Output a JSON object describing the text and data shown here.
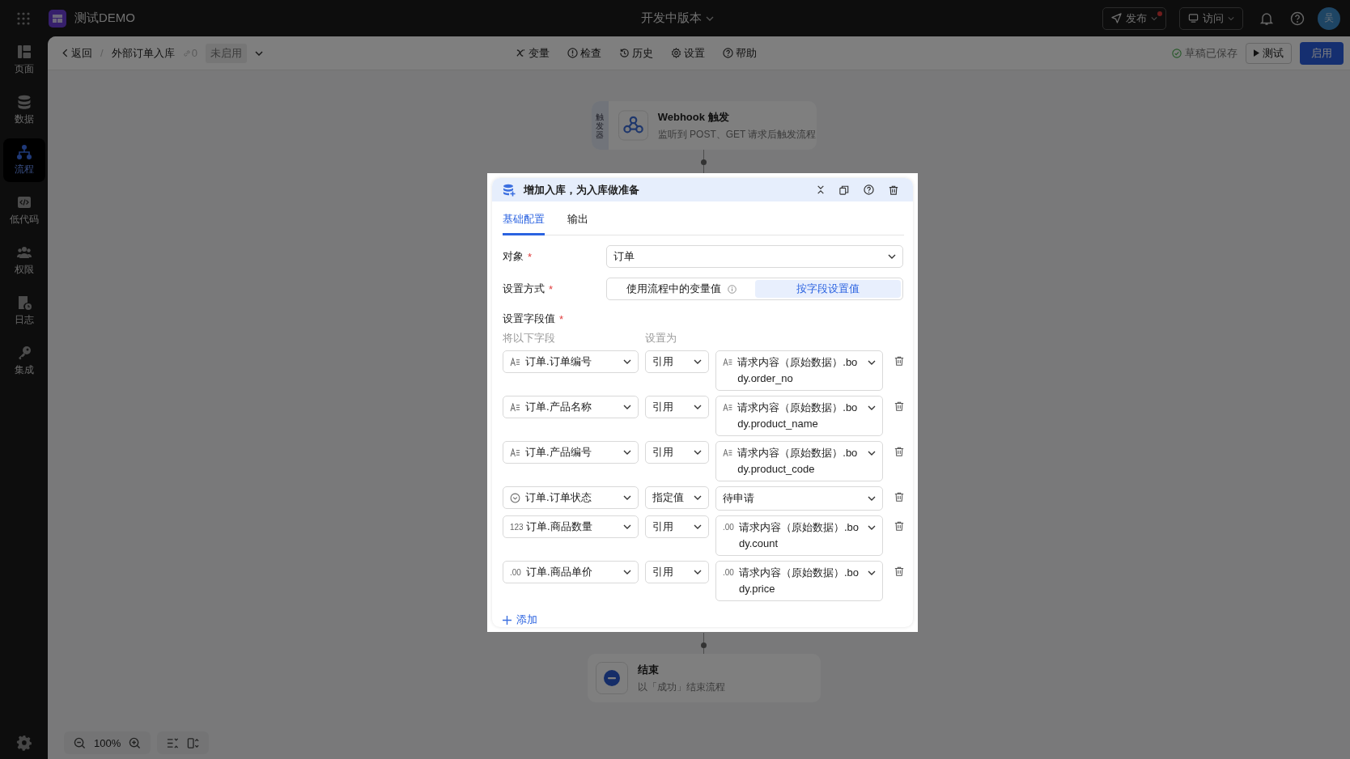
{
  "topbar": {
    "app_name": "测试DEMO",
    "version": "开发中版本",
    "publish": {
      "label": "发布",
      "has_dot": true
    },
    "visit": "访问",
    "avatar": "吴"
  },
  "sidebar": {
    "items": [
      {
        "label": "页面",
        "kind": "page",
        "selected": false
      },
      {
        "label": "数据",
        "kind": "data",
        "selected": false
      },
      {
        "label": "流程",
        "kind": "flow",
        "selected": true
      },
      {
        "label": "低代码",
        "kind": "code",
        "selected": false
      },
      {
        "label": "权限",
        "kind": "users",
        "selected": false
      },
      {
        "label": "日志",
        "kind": "log",
        "selected": false
      },
      {
        "label": "集成",
        "kind": "key",
        "selected": false
      }
    ]
  },
  "subheader": {
    "back": "返回",
    "separator": "/",
    "flow_name": "外部订单入库",
    "link_count": "0",
    "status": "未启用",
    "tools": [
      {
        "label": "变量",
        "kind": "var"
      },
      {
        "label": "检查",
        "kind": "check"
      },
      {
        "label": "历史",
        "kind": "history"
      },
      {
        "label": "设置",
        "kind": "settings"
      },
      {
        "label": "帮助",
        "kind": "help"
      }
    ],
    "saved": "草稿已保存",
    "test": "测试",
    "enable": "启用"
  },
  "canvas": {
    "trigger": {
      "tag": "触发器",
      "title": "Webhook 触发",
      "description": "监听到 POST、GET 请求后触发流程"
    },
    "end": {
      "title": "结束",
      "description": "以「成功」结束流程"
    },
    "zoom": "100%"
  },
  "dialog": {
    "title": "增加入库，为入库做准备",
    "tabs": [
      {
        "label": "基础配置",
        "selected": true
      },
      {
        "label": "输出",
        "selected": false
      }
    ],
    "object_label": {
      "text": "对象",
      "required_mark": "*"
    },
    "object_value": "订单",
    "mode_label": {
      "text": "设置方式",
      "required_mark": "*"
    },
    "modes": [
      {
        "label": "使用流程中的变量值",
        "info": true,
        "selected": false
      },
      {
        "label": "按字段设置值",
        "info": false,
        "selected": true
      }
    ],
    "fields_label": {
      "text": "设置字段值",
      "required_mark": "*"
    },
    "col_field": "将以下字段",
    "col_set": "设置为",
    "rows": [
      {
        "field": {
          "kind": "text",
          "label": "订单.订单编号"
        },
        "mode": "引用",
        "value": {
          "kind": "text",
          "label": "请求内容（原始数据）.body.order_no"
        }
      },
      {
        "field": {
          "kind": "text",
          "label": "订单.产品名称"
        },
        "mode": "引用",
        "value": {
          "kind": "text",
          "label": "请求内容（原始数据）.body.product_name"
        }
      },
      {
        "field": {
          "kind": "text",
          "label": "订单.产品编号"
        },
        "mode": "引用",
        "value": {
          "kind": "text",
          "label": "请求内容（原始数据）.body.product_code"
        }
      },
      {
        "field": {
          "kind": "option",
          "label": "订单.订单状态"
        },
        "mode": "指定值",
        "value": {
          "kind": "plain",
          "label": "待申请"
        }
      },
      {
        "field": {
          "kind": "mark",
          "mark": "123",
          "label": "订单.商品数量"
        },
        "mode": "引用",
        "value": {
          "kind": "mark",
          "mark": ".00",
          "label": "请求内容（原始数据）.body.count"
        }
      },
      {
        "field": {
          "kind": "mark",
          "mark": ".00",
          "label": "订单.商品单价"
        },
        "mode": "引用",
        "value": {
          "kind": "mark",
          "mark": ".00",
          "label": "请求内容（原始数据）.body.price"
        }
      }
    ],
    "add": "添加"
  }
}
